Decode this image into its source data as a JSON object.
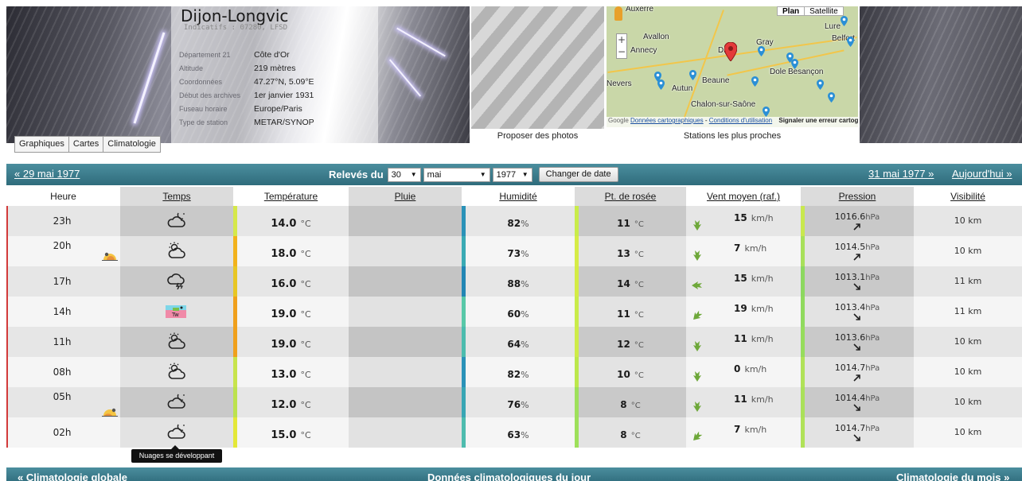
{
  "station": {
    "name": "Dijon-Longvic",
    "ids": "Indicatifs : 07280, LFSD",
    "info": [
      {
        "label": "Département 21",
        "value": "Côte d'Or"
      },
      {
        "label": "Altitude",
        "value": "219 mètres"
      },
      {
        "label": "Coordonnées",
        "value": "47.27°N, 5.09°E"
      },
      {
        "label": "Début des archives",
        "value": "1er janvier 1931"
      },
      {
        "label": "Fuseau horaire",
        "value": "Europe/Paris"
      },
      {
        "label": "Type de station",
        "value": "METAR/SYNOP"
      }
    ]
  },
  "tabs": [
    "Graphiques",
    "Cartes",
    "Climatologie"
  ],
  "photos_label": "Proposer des photos",
  "map": {
    "label": "Stations les plus proches",
    "type_plan": "Plan",
    "type_satellite": "Satellite",
    "zoom_in": "+",
    "zoom_out": "−",
    "cities": [
      "Auxerre",
      "Avallon",
      "Gray",
      "Lure",
      "Belfort",
      "Dijon",
      "Beaune",
      "Autun",
      "Dole",
      "Besançon",
      "Chalon-sur-Saône",
      "Annecy",
      "Nevers"
    ],
    "footer_data": "Données cartographiques",
    "footer_terms": "Conditions d'utilisation",
    "footer_error": "Signaler une erreur cartographique",
    "google": "Google"
  },
  "nav": {
    "prev": "« 29 mai 1977",
    "releves": "Relevés du",
    "day": "30",
    "month": "mai",
    "year": "1977",
    "change_button": "Changer de date",
    "next": "31 mai 1977 »",
    "today": "Aujourd'hui »"
  },
  "columns": {
    "heure": "Heure",
    "temps": "Temps",
    "temperature": "Température",
    "pluie": "Pluie",
    "humidite": "Humidité",
    "rosee": "Pt. de rosée",
    "vent": "Vent moyen (raf.)",
    "pression": "Pression",
    "visibilite": "Visibilité"
  },
  "units": {
    "temp": "°C",
    "hum": "%",
    "wind": "km/h",
    "press": "hPa"
  },
  "rows": [
    {
      "heure": "23h",
      "weather_icon": "night-cloud-icon",
      "temp": "14.0",
      "temp_color": "#d6e84a",
      "hum": "82",
      "hum_color": "#2a92b8",
      "dew": "11",
      "dew_color": "#c9ec4a",
      "wind": "15",
      "wind_dir": "north",
      "press": "1016.6",
      "press_trend": "rising",
      "press_color": "#c8e84e",
      "vis": "10 km"
    },
    {
      "heure": "20h",
      "sun_icon": "sunset-icon",
      "weather_icon": "partly-cloudy-icon",
      "temp": "18.0",
      "temp_color": "#f2b21c",
      "hum": "73",
      "hum_color": "#3aaab4",
      "dew": "13",
      "dew_color": "#d6ec46",
      "wind": "7",
      "wind_dir": "north",
      "press": "1014.5",
      "press_trend": "rising",
      "press_color": "#a8e05a",
      "vis": "10 km"
    },
    {
      "heure": "17h",
      "weather_icon": "thunder-cloud-icon",
      "temp": "16.0",
      "temp_color": "#e8c624",
      "hum": "88",
      "hum_color": "#2286b4",
      "dew": "14",
      "dew_color": "#d4ec44",
      "wind": "15",
      "wind_dir": "east",
      "press": "1013.1",
      "press_trend": "falling",
      "press_color": "#8cd860",
      "vis": "11 km"
    },
    {
      "heure": "14h",
      "weather_icon": "thunderstorm-map-icon",
      "temp": "19.0",
      "temp_color": "#f0a01c",
      "hum": "60",
      "hum_color": "#58c8a8",
      "dew": "11",
      "dew_color": "#c9ec4a",
      "wind": "19",
      "wind_dir": "northeast",
      "press": "1013.4",
      "press_trend": "falling",
      "press_color": "#90da5e",
      "vis": "11 km"
    },
    {
      "heure": "11h",
      "weather_icon": "partly-cloudy-icon",
      "temp": "19.0",
      "temp_color": "#f0a01c",
      "hum": "64",
      "hum_color": "#4cbcae",
      "dew": "12",
      "dew_color": "#ceec48",
      "wind": "11",
      "wind_dir": "north",
      "press": "1013.6",
      "press_trend": "falling",
      "press_color": "#96dc5c",
      "vis": "10 km"
    },
    {
      "heure": "08h",
      "weather_icon": "partly-cloudy-icon",
      "temp": "13.0",
      "temp_color": "#c8e44c",
      "hum": "82",
      "hum_color": "#2a92b8",
      "dew": "10",
      "dew_color": "#bce84c",
      "wind": "0",
      "wind_dir": "north",
      "press": "1014.7",
      "press_trend": "rising",
      "press_color": "#b0e258",
      "vis": "10 km"
    },
    {
      "heure": "05h",
      "sun_icon": "sunrise-icon",
      "weather_icon": "night-cloud-icon",
      "temp": "12.0",
      "temp_color": "#bce24e",
      "hum": "76",
      "hum_color": "#38a6b4",
      "dew": "8",
      "dew_color": "#9ee05a",
      "wind": "11",
      "wind_dir": "north",
      "press": "1014.4",
      "press_trend": "falling",
      "press_color": "#aae05a",
      "vis": "10 km"
    },
    {
      "heure": "02h",
      "weather_icon": "night-cloud-icon",
      "temp": "15.0",
      "temp_color": "#e4e838",
      "hum": "63",
      "hum_color": "#4ebcae",
      "dew": "8",
      "dew_color": "#9ee05a",
      "wind": "7",
      "wind_dir": "northeast",
      "press": "1014.7",
      "press_trend": "falling",
      "press_color": "#b0e258",
      "vis": "10 km"
    }
  ],
  "tooltip": "Nuages se développant",
  "footer": {
    "left": "« Climatologie globale",
    "center": "Données climatologiques du jour",
    "right": "Climatologie du mois »"
  }
}
